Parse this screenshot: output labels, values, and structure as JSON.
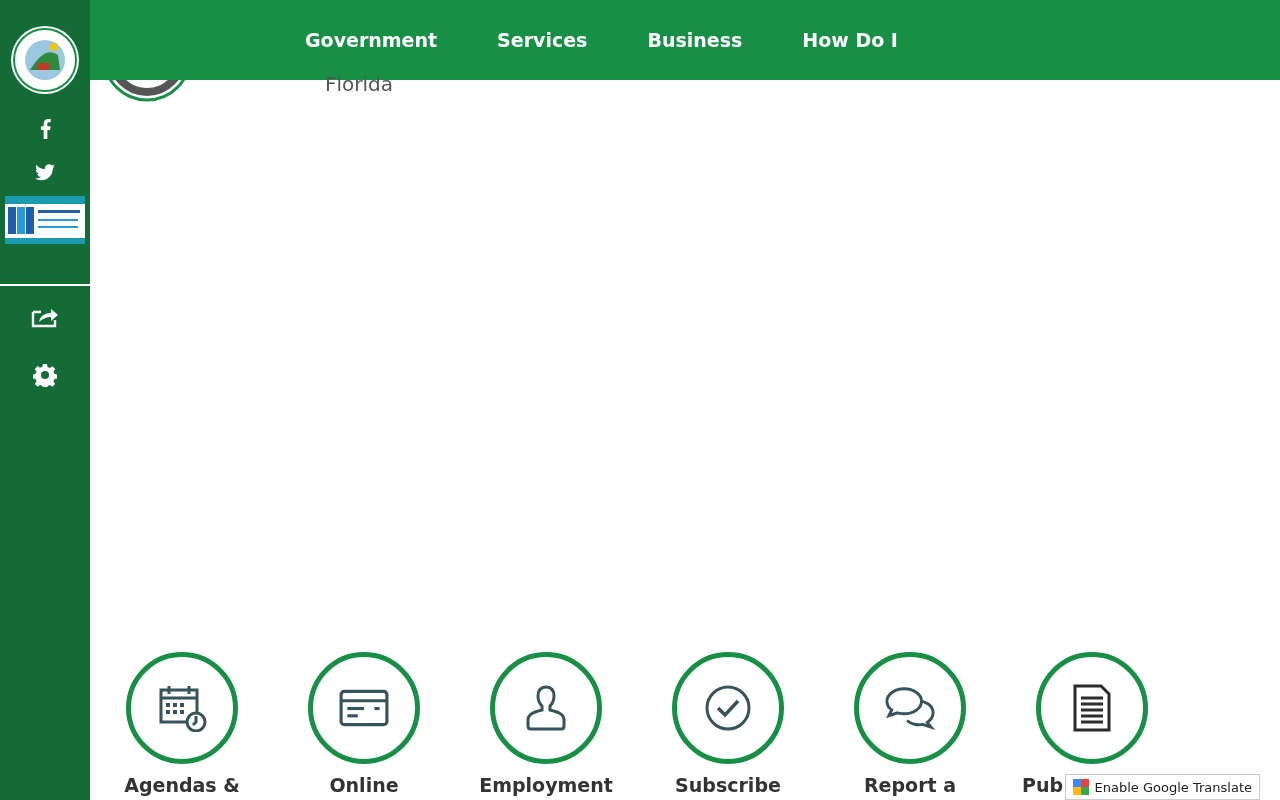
{
  "nav": {
    "items": [
      "Government",
      "Services",
      "Business",
      "How Do I"
    ]
  },
  "header": {
    "subtitle": "Florida"
  },
  "quick_links": [
    {
      "kind": "calendar",
      "label": "Agendas &"
    },
    {
      "kind": "card",
      "label": "Online"
    },
    {
      "kind": "person",
      "label": "Employment"
    },
    {
      "kind": "check",
      "label": "Subscribe"
    },
    {
      "kind": "chat",
      "label": "Report a"
    },
    {
      "kind": "document",
      "label": "Pub"
    }
  ],
  "translate_button": {
    "label": "Enable Google Translate"
  }
}
